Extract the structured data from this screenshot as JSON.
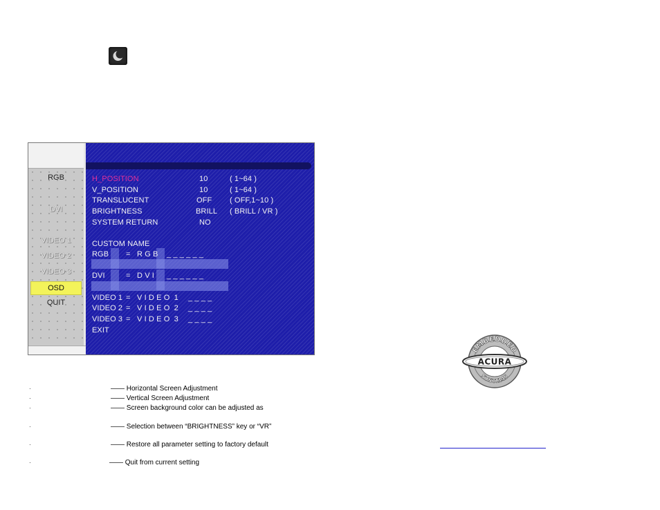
{
  "icon": {
    "name": "moon-icon"
  },
  "osd": {
    "sidebar": {
      "items": [
        {
          "label": "RGB",
          "state": "normal"
        },
        {
          "label": "DVI",
          "state": "dim"
        },
        {
          "label": "VIDEO 1",
          "state": "dim"
        },
        {
          "label": "VIDEO 2",
          "state": "dim"
        },
        {
          "label": "VIDEO 3",
          "state": "dim"
        },
        {
          "label": "OSD",
          "state": "active"
        },
        {
          "label": "QUIT",
          "state": "normal"
        }
      ],
      "active_color": "#f3f35a"
    },
    "settings": [
      {
        "name": "H_POSITION",
        "value": "10",
        "range": "( 1~64 )",
        "highlighted": true
      },
      {
        "name": "V_POSITION",
        "value": "10",
        "range": "( 1~64 )"
      },
      {
        "name": "TRANSLUCENT",
        "value": "OFF",
        "range": "( OFF,1~10 )"
      },
      {
        "name": "BRIGHTNESS",
        "value": "BRILL",
        "range": "( BRILL / VR )"
      },
      {
        "name": "SYSTEM RETURN",
        "value": "NO",
        "range": ""
      }
    ],
    "custom_name_header": "CUSTOM NAME",
    "custom_names": [
      {
        "source": "RGB",
        "sep": "=",
        "name": "R G B",
        "blanks": "_ _ _ _ _ _"
      },
      {
        "source": "DVI",
        "sep": "=",
        "name": "D V I",
        "blanks": "_ _ _ _ _ _"
      },
      {
        "source": "VIDEO 1",
        "sep": "=",
        "name": "V I D E O  1",
        "blanks": "_ _ _ _"
      },
      {
        "source": "VIDEO 2",
        "sep": "=",
        "name": "V I D E O  2",
        "blanks": "_ _ _ _"
      },
      {
        "source": "VIDEO 3",
        "sep": "=",
        "name": "V I D E O  3",
        "blanks": "_ _ _ _"
      }
    ],
    "exit_label": "EXIT",
    "colors": {
      "background": "#1e1eaa",
      "highlight": "#e0309a",
      "text": "#f2f2f2"
    }
  },
  "notes": [
    {
      "bullet": "·",
      "text": "—— Horizontal Screen Adjustment"
    },
    {
      "bullet": "·",
      "text": "—— Vertical Screen Adjustment"
    },
    {
      "bullet": "·",
      "text": "—— Screen background color can be adjusted as"
    },
    {
      "bullet": "·",
      "text": "—— Selection between “BRIGHTNESS” key or “VR”"
    },
    {
      "bullet": "·",
      "text": "—— Restore all parameter setting to factory default"
    },
    {
      "bullet": "·",
      "text": "—— Quit from current setting"
    }
  ],
  "logo": {
    "top_text": "EMBEDDED",
    "center_text": "ACURA",
    "bottom_text": "SYSTEMS"
  }
}
